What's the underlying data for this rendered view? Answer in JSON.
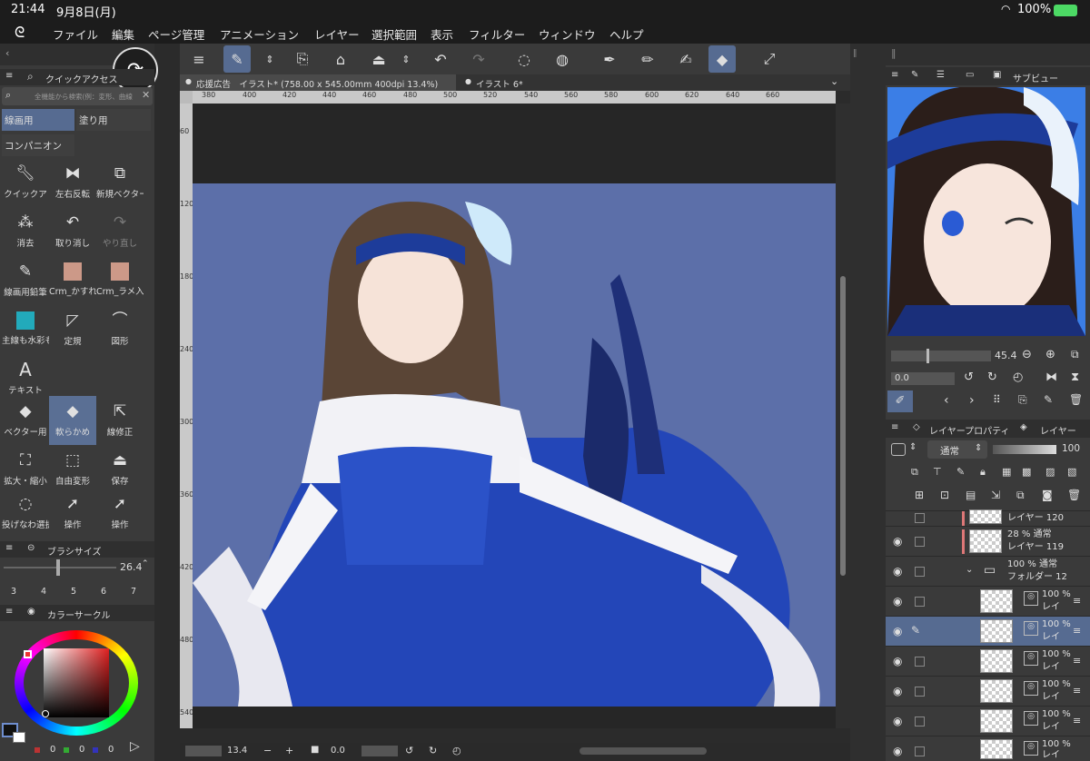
{
  "status": {
    "time": "21:44",
    "date": "9月8日(月)",
    "battery": "100%"
  },
  "menu": [
    "ファイル",
    "編集",
    "ページ管理",
    "アニメーション",
    "レイヤー",
    "選択範囲",
    "表示",
    "フィルター",
    "ウィンドウ",
    "ヘルプ"
  ],
  "tabs": {
    "active": "応援広告　イラスト* (758.00 x 545.00mm 400dpi 13.4%)",
    "other": "イラスト 6*"
  },
  "ruler_h": [
    "380",
    "400",
    "420",
    "440",
    "460",
    "480",
    "500",
    "520",
    "540",
    "560",
    "580",
    "600",
    "620",
    "640",
    "660"
  ],
  "ruler_v": [
    "60",
    "120",
    "180",
    "240",
    "300",
    "360",
    "420",
    "480",
    "540"
  ],
  "quick_access": {
    "title": "クイックアクセス",
    "search_placeholder": "全機能から検索(例：変形、曲線",
    "tabs": [
      "線画用",
      "塗り用",
      "コンパニオン"
    ],
    "tools": [
      "クイックア",
      "左右反転",
      "新規ベクター",
      "消去",
      "取り消し",
      "やり直し",
      "線画用鉛筆",
      "Crm_かすれ",
      "Crm_ラメ入",
      "主線も水彩も",
      "定規",
      "図形",
      "テキスト",
      "ベクター用",
      "軟らかめ",
      "線修正",
      "拡大・縮小",
      "自由変形",
      "保存",
      "投げなわ選択",
      "操作",
      "操作"
    ]
  },
  "brush": {
    "title": "ブラシサイズ",
    "value": "26.4",
    "sizes": [
      "3",
      "4",
      "5",
      "6",
      "7"
    ]
  },
  "color": {
    "title": "カラーサークル",
    "values": [
      "0",
      "0",
      "0"
    ]
  },
  "subview": {
    "title": "サブビュー",
    "zoom": "45.4",
    "rotation": "0.0"
  },
  "layers": {
    "tab_prop": "レイヤープロパティ",
    "tab_layer": "レイヤー",
    "blend": "通常",
    "opacity": "100",
    "rows": [
      {
        "line1": "",
        "line2": "レイヤー 120"
      },
      {
        "line1": "28 % 通常",
        "line2": "レイヤー 119"
      },
      {
        "line1": "100 % 通常",
        "line2": "フォルダー 12"
      },
      {
        "line1": "100 %",
        "line2": "レイ"
      },
      {
        "line1": "100 %",
        "line2": "レイ"
      },
      {
        "line1": "100 %",
        "line2": "レイ"
      },
      {
        "line1": "100 %",
        "line2": "レイ"
      },
      {
        "line1": "100 %",
        "line2": "レイ"
      },
      {
        "line1": "100 %",
        "line2": "レイ"
      }
    ]
  },
  "bottom": {
    "zoom": "13.4",
    "rotation": "0.0"
  }
}
